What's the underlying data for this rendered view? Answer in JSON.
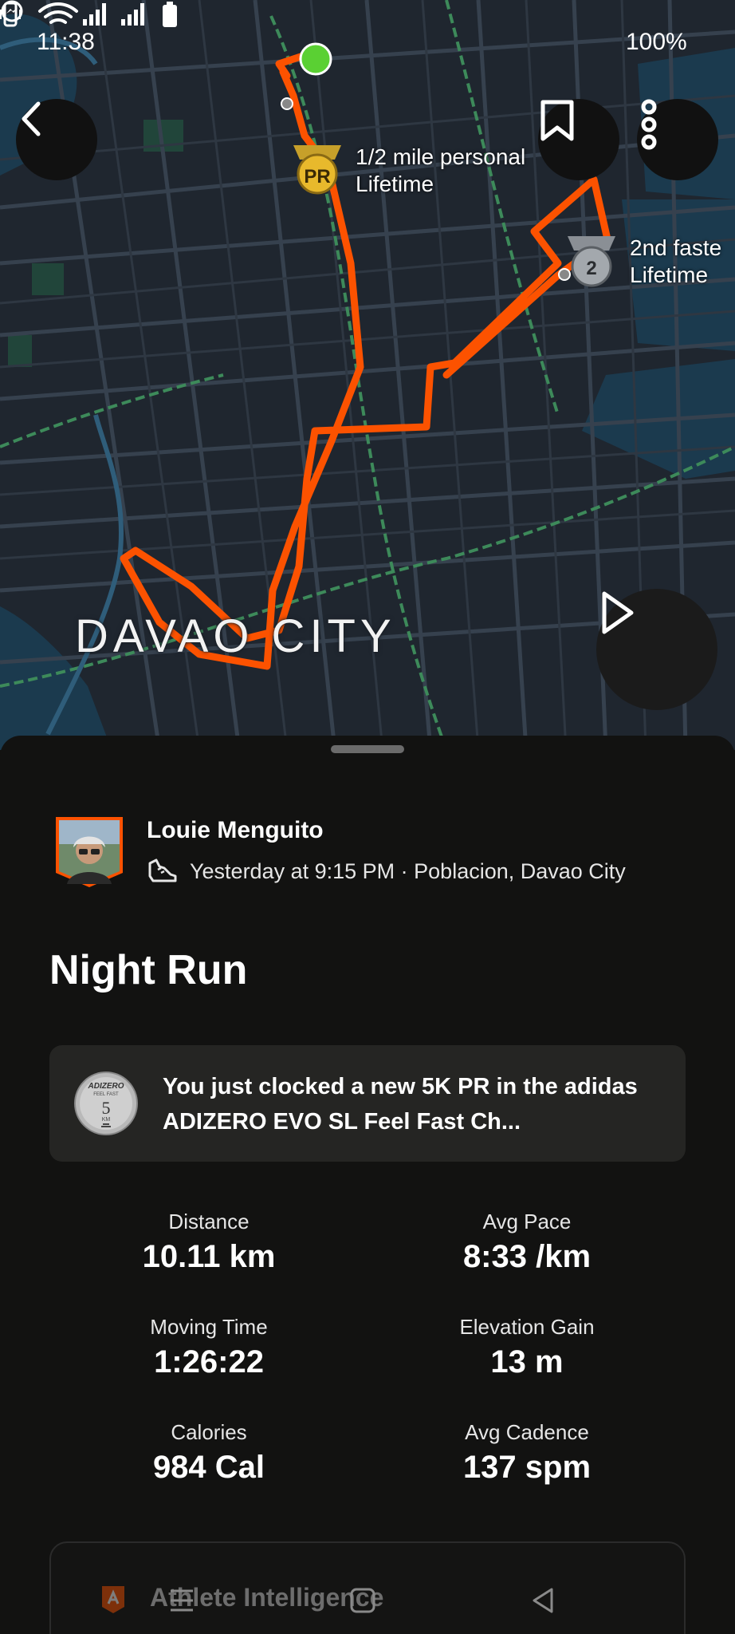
{
  "status_bar": {
    "time": "11:38",
    "battery_percent": "100%",
    "icons": [
      "messenger-icon",
      "vibrate-icon",
      "wifi-icon",
      "signal-icon",
      "signal-icon",
      "battery-icon"
    ]
  },
  "map": {
    "city_label": "DAVAO CITY",
    "annotations": [
      {
        "icon": "pr-medal-icon",
        "line1": "1/2 mile personal",
        "line2": "Lifetime"
      },
      {
        "icon": "silver-medal-icon",
        "line1": "2nd faste",
        "line2": "Lifetime",
        "rank": "2"
      }
    ],
    "route_color": "#fc5200",
    "start_marker_color": "#5ad033"
  },
  "header_buttons": {
    "back": "back-arrow-icon",
    "save": "bookmark-icon",
    "more": "more-vertical-icon",
    "play": "play-icon"
  },
  "athlete": {
    "name": "Louie Menguito",
    "meta": "Yesterday at 9:15 PM · Poblacion, Davao City",
    "activity_icon": "run-shoe-icon"
  },
  "activity": {
    "title": "Night Run"
  },
  "promo": {
    "text": "You just clocked a new 5K PR in the adidas ADIZERO EVO SL Feel Fast Ch...",
    "badge_brand": "ADIZERO",
    "badge_tag": "FEEL FAST",
    "badge_number": "5",
    "badge_unit": "KM"
  },
  "stats": [
    {
      "label": "Distance",
      "value": "10.11 km"
    },
    {
      "label": "Avg Pace",
      "value": "8:33 /km"
    },
    {
      "label": "Moving Time",
      "value": "1:26:22"
    },
    {
      "label": "Elevation Gain",
      "value": "13 m"
    },
    {
      "label": "Calories",
      "value": "984 Cal"
    },
    {
      "label": "Avg Cadence",
      "value": "137 spm"
    }
  ],
  "athlete_intelligence": {
    "label": "Athlete Intelligence"
  },
  "nav_bar": {
    "items": [
      "recents-icon",
      "home-icon",
      "back-icon"
    ]
  },
  "colors": {
    "accent": "#fc5200",
    "sheet_bg": "#121211",
    "card_bg": "#252523",
    "map_bg": "#1f262f"
  }
}
